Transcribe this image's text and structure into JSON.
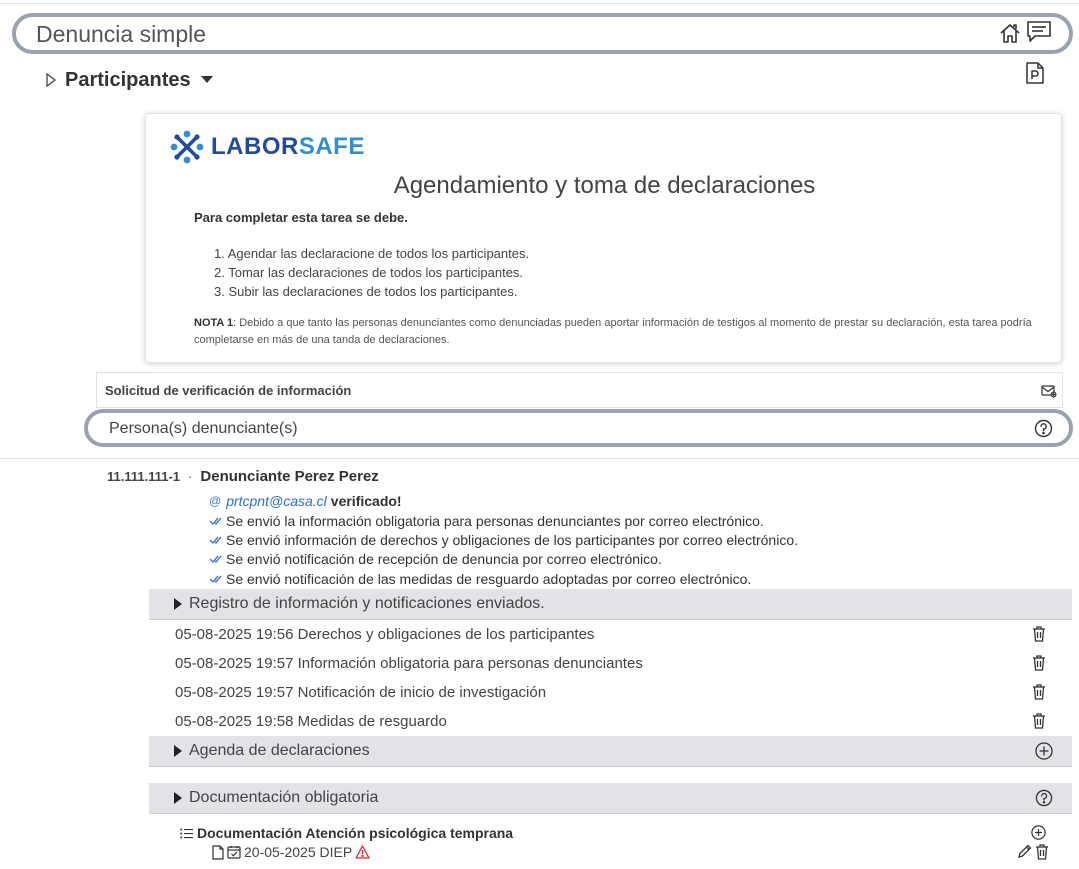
{
  "header": {
    "title": "Denuncia simple",
    "icons": [
      "home-icon",
      "chat-icon"
    ]
  },
  "participants": {
    "title": "Participantes",
    "pdf_icon": "pdf-icon"
  },
  "card": {
    "brand_a": "LABOR",
    "brand_b": "SAFE",
    "title": "Agendamiento y toma de declaraciones",
    "intro": "Para completar esta tarea se debe.",
    "steps": [
      "1. Agendar las declaracione de todos los participantes.",
      "2. Tomar las declaraciones de todos los participantes.",
      "3. Subir las declaraciones de todos los participantes."
    ],
    "note_label": "NOTA 1",
    "note_text": ": Debido a que tanto las personas denunciantes como denunciadas pueden aportar información de testigos al momento de prestar su declaración, esta tarea podría completarse en más de una tanda de declaraciones."
  },
  "verification": {
    "label": "Solicitud de verificación de información"
  },
  "denunciantes": {
    "label": "Persona(s) denunciante(s)"
  },
  "person": {
    "rut": "11.111.111-1",
    "separator": "·",
    "name": "Denunciante Perez Perez",
    "at_symbol": "@",
    "email": "prtcpnt@casa.cl",
    "verified": "verificado!",
    "messages": [
      "Se envió la información obligatoria para personas denunciantes por correo electrónico.",
      "Se envió información de derechos y obligaciones de los participantes por correo electrónico.",
      "Se envió notificación de recepción de denuncia por correo electrónico.",
      "Se envió notificación de las medidas de resguardo adoptadas por correo electrónico."
    ]
  },
  "sections": {
    "registro": "Registro de información y notificaciones enviados.",
    "agenda": "Agenda de declaraciones",
    "documentacion": "Documentación obligatoria"
  },
  "log": [
    "05-08-2025 19:56 Derechos y obligaciones de los participantes",
    "05-08-2025 19:57 Información obligatoria para personas denunciantes",
    "05-08-2025 19:57 Notificación de inicio de investigación",
    "05-08-2025 19:58 Medidas de resguardo"
  ],
  "documents": {
    "group_title": "Documentación Atención psicológica temprana",
    "item_label": "20-05-2025 DIEP"
  },
  "colors": {
    "outline": "#9aa3ad",
    "section_bg": "#e1e3e6",
    "link": "#2b6fc7",
    "warning": "#e02424",
    "brand_dark": "#1f4b9a",
    "brand_light": "#2f8fd1"
  }
}
